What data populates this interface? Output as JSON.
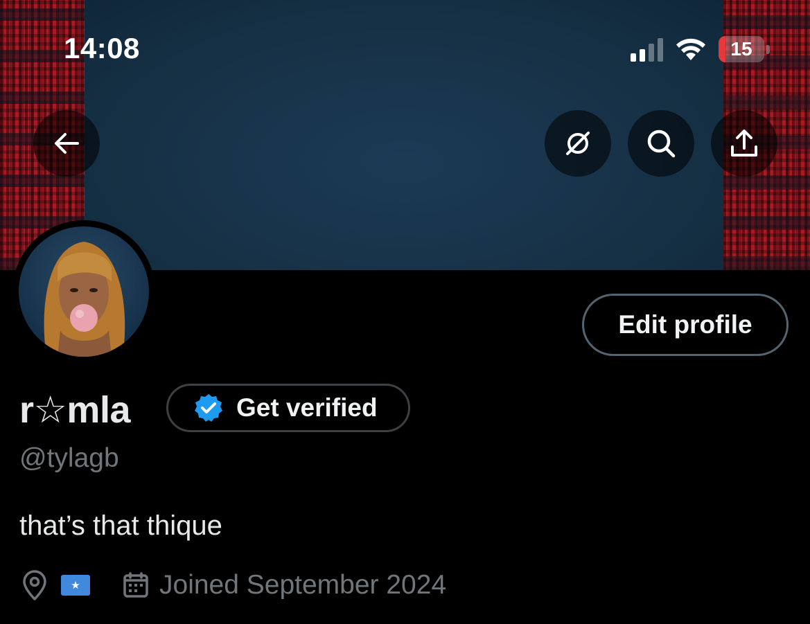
{
  "status_bar": {
    "time": "14:08",
    "battery_level": "15",
    "battery_fraction": 0.15,
    "battery_color": "#e5383b"
  },
  "nav": {
    "back_icon": "arrow-left-icon",
    "grok_icon": "grok-icon",
    "search_icon": "search-icon",
    "share_icon": "share-icon"
  },
  "profile": {
    "display_name": "r☆mla",
    "handle": "@tylagb",
    "bio": "that’s that thique",
    "location_flag": "★",
    "joined": "Joined September 2024",
    "edit_profile_label": "Edit profile",
    "get_verified_label": "Get verified"
  },
  "colors": {
    "accent_blue": "#1d9bf0",
    "muted_text": "#71767b",
    "background": "#000000"
  }
}
